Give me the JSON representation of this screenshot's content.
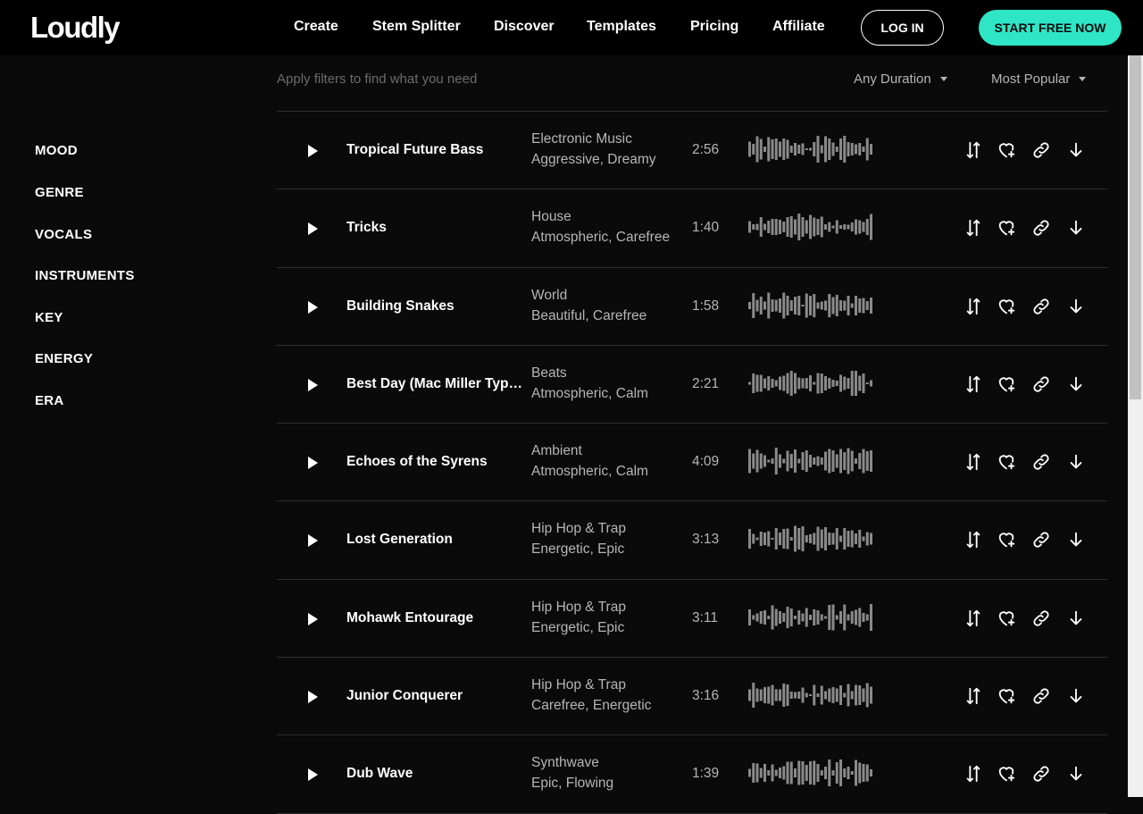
{
  "brand": {
    "logo": "Loudly"
  },
  "nav": {
    "items": [
      "Create",
      "Stem Splitter",
      "Discover",
      "Templates",
      "Pricing",
      "Affiliate"
    ],
    "login": "LOG IN",
    "start": "START FREE NOW"
  },
  "colors": {
    "accent": "#2ee6c5",
    "background": "#0a0a0a",
    "text_muted": "#b5b5b5"
  },
  "sidebar": {
    "items": [
      "MOOD",
      "GENRE",
      "VOCALS",
      "INSTRUMENTS",
      "KEY",
      "ENERGY",
      "ERA"
    ]
  },
  "filters": {
    "hint": "Apply filters to find what you need",
    "duration": "Any Duration",
    "sort": "Most Popular"
  },
  "icons": {
    "play": "play-icon",
    "stems": "stems-icon",
    "favorite": "heart-plus-icon",
    "share": "link-icon",
    "download": "download-icon"
  },
  "tracks": [
    {
      "title": "Tropical Future Bass",
      "genre": "Electronic Music",
      "moods": "Aggressive, Dreamy",
      "duration": "2:56"
    },
    {
      "title": "Tricks",
      "genre": "House",
      "moods": "Atmospheric, Carefree",
      "duration": "1:40"
    },
    {
      "title": "Building Snakes",
      "genre": "World",
      "moods": "Beautiful, Carefree",
      "duration": "1:58"
    },
    {
      "title": "Best Day (Mac Miller Type Beat)",
      "genre": "Beats",
      "moods": "Atmospheric, Calm",
      "duration": "2:21"
    },
    {
      "title": "Echoes of the Syrens",
      "genre": "Ambient",
      "moods": "Atmospheric, Calm",
      "duration": "4:09"
    },
    {
      "title": "Lost Generation",
      "genre": "Hip Hop & Trap",
      "moods": "Energetic, Epic",
      "duration": "3:13"
    },
    {
      "title": "Mohawk Entourage",
      "genre": "Hip Hop & Trap",
      "moods": "Energetic, Epic",
      "duration": "3:11"
    },
    {
      "title": "Junior Conquerer",
      "genre": "Hip Hop & Trap",
      "moods": "Carefree, Energetic",
      "duration": "3:16"
    },
    {
      "title": "Dub Wave",
      "genre": "Synthwave",
      "moods": "Epic, Flowing",
      "duration": "1:39"
    }
  ]
}
